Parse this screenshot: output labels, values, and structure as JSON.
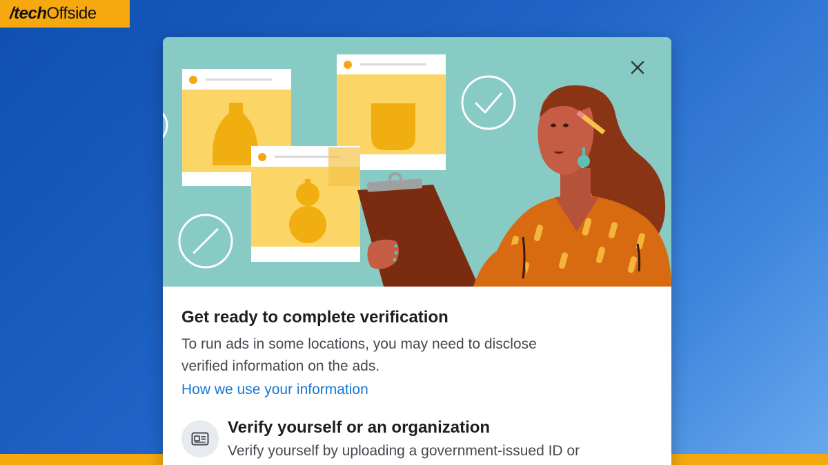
{
  "brand": {
    "part1": "/tech",
    "part2": "Offside"
  },
  "dialog": {
    "close_icon": "close-icon",
    "title": "Get ready to complete verification",
    "description_line1": "To run ads in some locations, you may need to disclose",
    "description_line2": "verified information on the ads.",
    "link": "How we use your information",
    "option": {
      "icon": "id-card-icon",
      "title": "Verify yourself or an organization",
      "description": "Verify yourself by uploading a government-issued ID or"
    }
  },
  "colors": {
    "background": "#1f63c6",
    "brand": "#f6a90f",
    "hero": "#88cbc4",
    "link": "#1877d2",
    "title": "#1c1e21"
  }
}
